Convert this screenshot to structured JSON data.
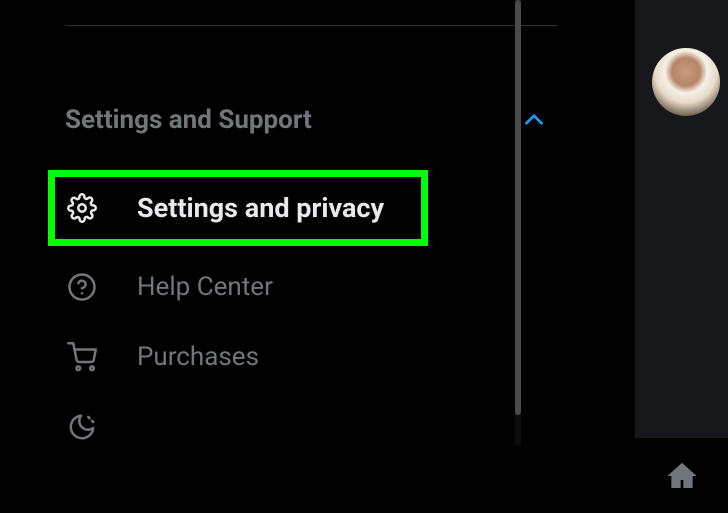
{
  "section": {
    "title": "Settings and Support",
    "expanded": true
  },
  "menu": {
    "items": [
      {
        "label": "Settings and privacy",
        "icon": "gear-icon",
        "highlighted": true
      },
      {
        "label": "Help Center",
        "icon": "question-icon",
        "highlighted": false
      },
      {
        "label": "Purchases",
        "icon": "cart-icon",
        "highlighted": false
      },
      {
        "label": "",
        "icon": "moon-icon",
        "highlighted": false
      }
    ]
  },
  "icons": {
    "gear": "gear-icon",
    "question": "question-icon",
    "cart": "cart-icon",
    "moon": "moon-icon",
    "chevron_up": "chevron-up-icon",
    "home": "home-icon"
  },
  "colors": {
    "accent": "#1d9bf0",
    "highlight": "#00ff00",
    "text_primary": "#e7e9ea",
    "text_secondary": "#71767b"
  }
}
